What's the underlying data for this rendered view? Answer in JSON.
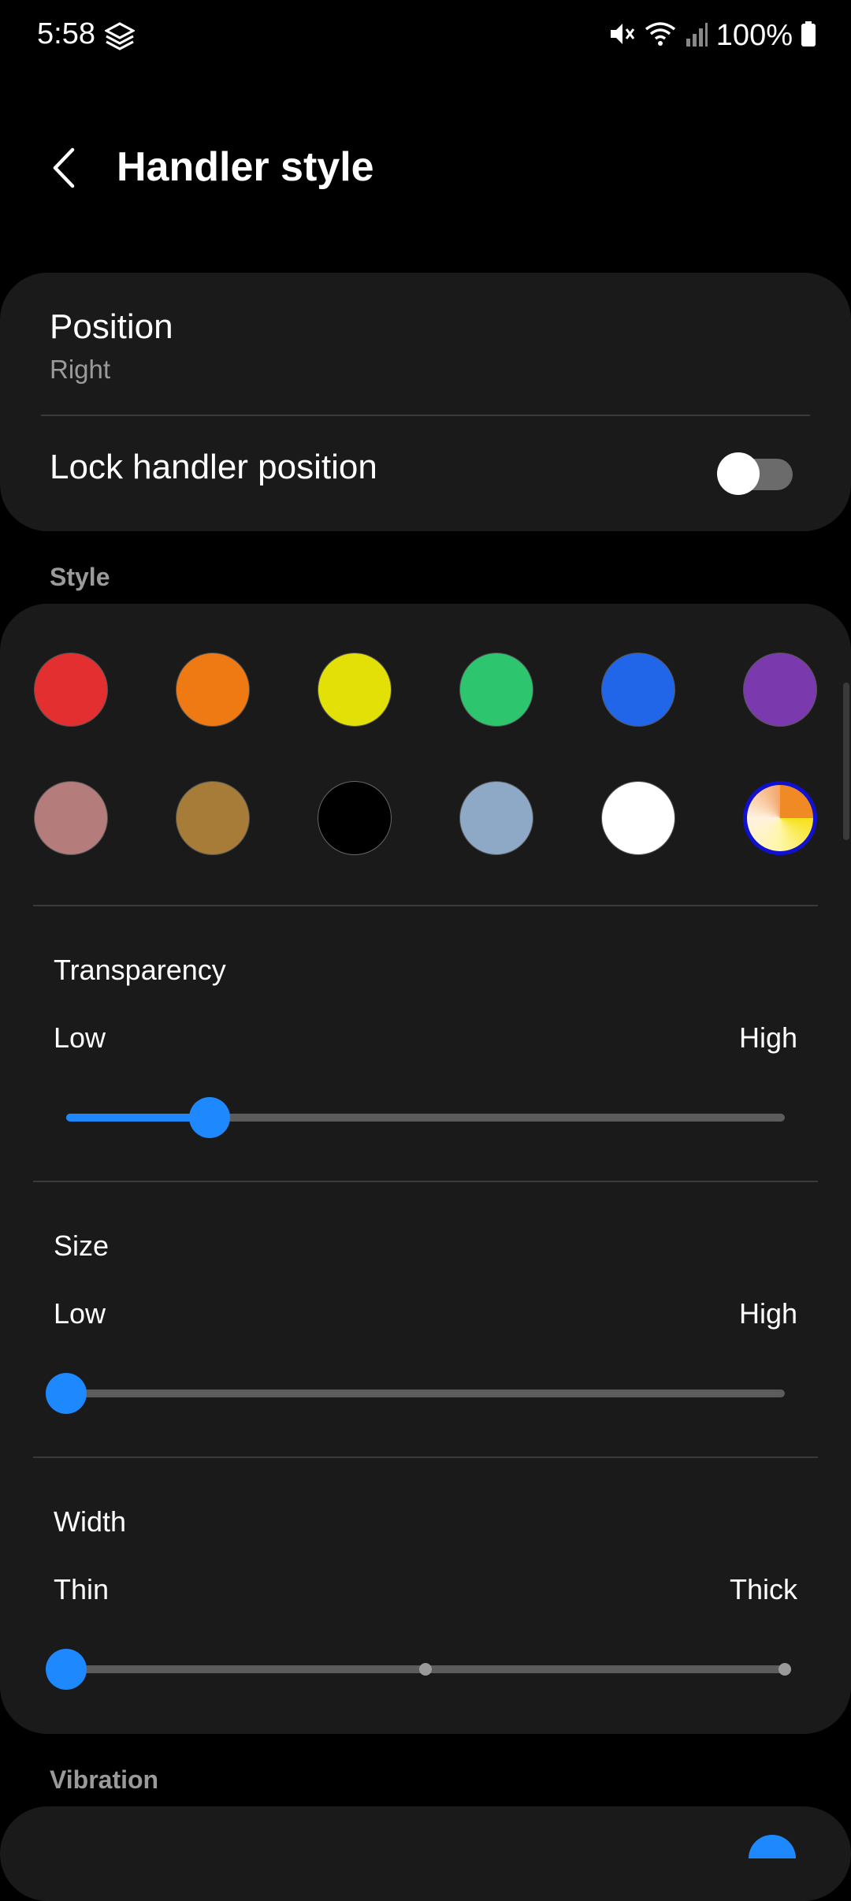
{
  "status_bar": {
    "time": "5:58",
    "battery_text": "100%",
    "icons": [
      "layers-icon",
      "mute-icon",
      "wifi-icon",
      "signal-icon",
      "battery-icon"
    ]
  },
  "app_bar": {
    "title": "Handler style",
    "back_icon": "chevron-left-icon"
  },
  "position": {
    "title": "Position",
    "value": "Right"
  },
  "lock": {
    "title": "Lock handler position",
    "enabled": false
  },
  "style_section": {
    "label": "Style",
    "swatches": [
      {
        "name": "red",
        "color": "#e32f2f"
      },
      {
        "name": "orange",
        "color": "#ef7a14"
      },
      {
        "name": "yellow",
        "color": "#e2e006"
      },
      {
        "name": "green",
        "color": "#2dc56d"
      },
      {
        "name": "blue",
        "color": "#2165e8"
      },
      {
        "name": "purple",
        "color": "#7a3aad"
      },
      {
        "name": "pink",
        "color": "#b47d7b"
      },
      {
        "name": "brown",
        "color": "#a77c39"
      },
      {
        "name": "black",
        "color": "#000000"
      },
      {
        "name": "light-blue",
        "color": "#8ea9c6"
      },
      {
        "name": "white",
        "color": "#ffffff"
      },
      {
        "name": "custom",
        "color": "gradient",
        "selected": true
      }
    ]
  },
  "transparency": {
    "title": "Transparency",
    "low": "Low",
    "high": "High",
    "value_fraction": 0.2
  },
  "size": {
    "title": "Size",
    "low": "Low",
    "high": "High",
    "value_fraction": 0.0
  },
  "width": {
    "title": "Width",
    "low": "Thin",
    "high": "Thick",
    "value_fraction": 0.0,
    "steps": 3
  },
  "vibration": {
    "label": "Vibration"
  },
  "colors": {
    "accent": "#1e88ff",
    "card": "#1a1a1a",
    "background": "#000000",
    "muted_text": "#9a9a9a"
  }
}
